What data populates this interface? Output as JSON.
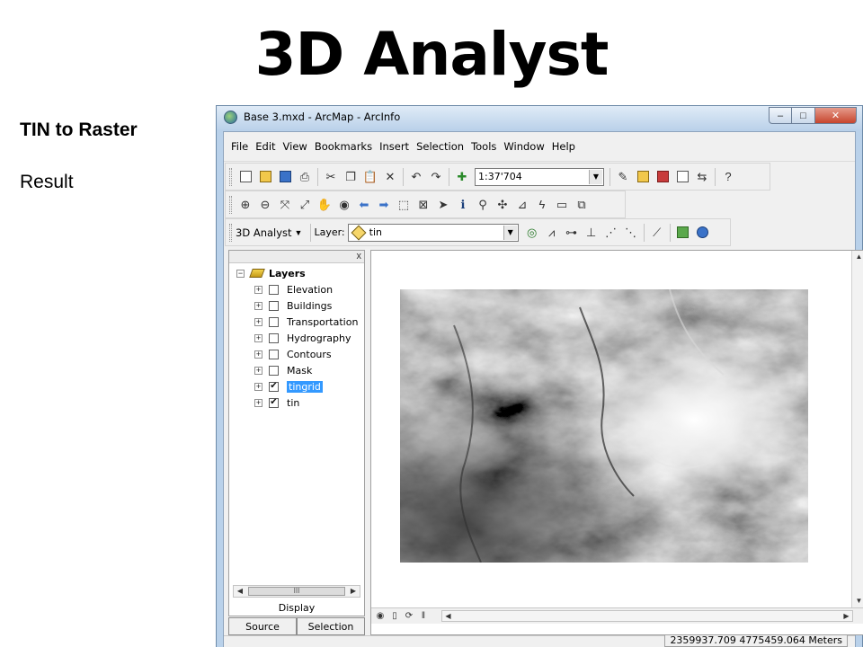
{
  "slide": {
    "title": "3D Analyst",
    "subtitle": "TIN to Raster",
    "result_label": "Result"
  },
  "window": {
    "title": "Base 3.mxd - ArcMap - ArcInfo",
    "controls": {
      "minimize": "–",
      "maximize": "□",
      "close": "✕"
    }
  },
  "menu": [
    "File",
    "Edit",
    "View",
    "Bookmarks",
    "Insert",
    "Selection",
    "Tools",
    "Window",
    "Help"
  ],
  "standard_toolbar": {
    "scale": "1:37'704"
  },
  "analyst_toolbar": {
    "name": "3D Analyst",
    "layer_label": "Layer:",
    "layer_value": "tin"
  },
  "toc": {
    "root": "Layers",
    "layers": [
      {
        "name": "Elevation",
        "checked": false,
        "selected": false
      },
      {
        "name": "Buildings",
        "checked": false,
        "selected": false
      },
      {
        "name": "Transportation",
        "checked": false,
        "selected": false
      },
      {
        "name": "Hydrography",
        "checked": false,
        "selected": false
      },
      {
        "name": "Contours",
        "checked": false,
        "selected": false
      },
      {
        "name": "Mask",
        "checked": false,
        "selected": false
      },
      {
        "name": "tingrid",
        "checked": true,
        "selected": true
      },
      {
        "name": "tin",
        "checked": true,
        "selected": false
      }
    ],
    "display_label": "Display",
    "tabs": {
      "source": "Source",
      "selection": "Selection"
    },
    "scroll_thumb": "III",
    "close_glyph": "x"
  },
  "status": {
    "coordinates": "2359937.709  4775459.064 Meters"
  },
  "icons": {
    "check": "✔",
    "expand": "+",
    "collapse": "−",
    "arrow_left": "◀",
    "arrow_right": "▶",
    "arrow_up": "▲",
    "arrow_down": "▼",
    "dropdown": "▼"
  }
}
